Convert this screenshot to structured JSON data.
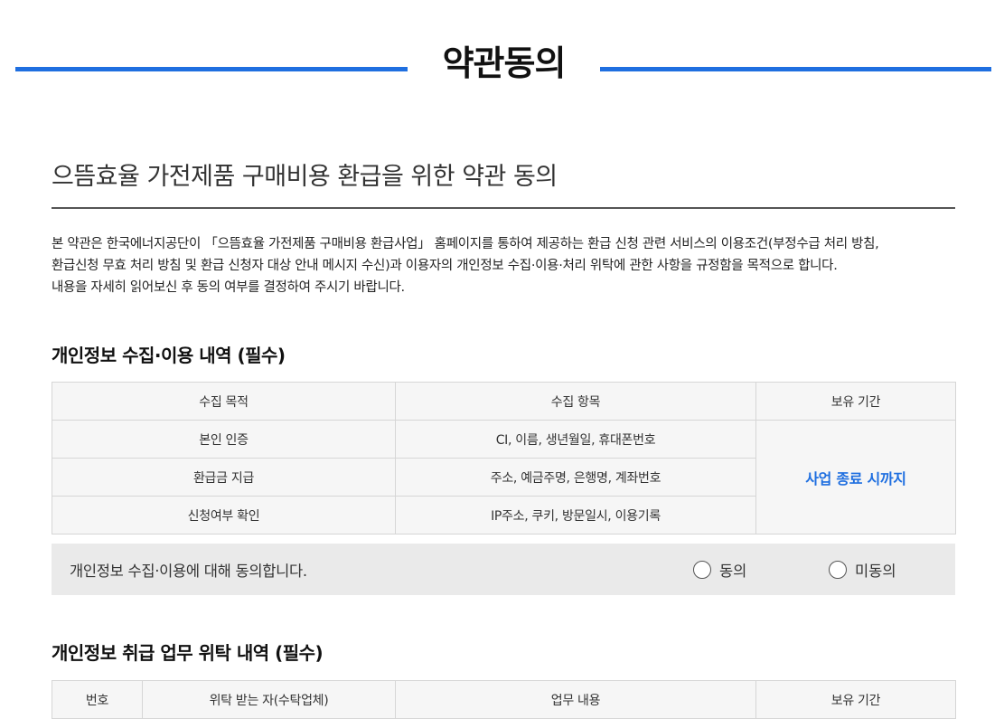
{
  "header": {
    "title": "약관동의"
  },
  "main": {
    "subtitle": "으뜸효율 가전제품 구매비용 환급을 위한 약관 동의",
    "intro": [
      "본 약관은 한국에너지공단이 「으뜸효율 가전제품 구매비용 환급사업」 홈페이지를 통하여 제공하는 환급 신청 관련 서비스의 이용조건(부정수급 처리 방침,",
      "환급신청 무효 처리 방침 및 환급 신청자 대상 안내 메시지 수신)과 이용자의 개인정보 수집·이용·처리 위탁에 관한 사항을 규정함을 목적으로 합니다.",
      "내용을 자세히 읽어보신 후 동의 여부를 결정하여 주시기 바랍니다."
    ]
  },
  "section1": {
    "title": "개인정보 수집·이용 내역 (필수)",
    "headers": [
      "수집 목적",
      "수집 항목",
      "보유 기간"
    ],
    "rows": [
      {
        "purpose": "본인 인증",
        "items": "CI, 이름, 생년월일, 휴대폰번호"
      },
      {
        "purpose": "환급금 지급",
        "items": "주소, 예금주명, 은행명, 계좌번호"
      },
      {
        "purpose": "신청여부 확인",
        "items": "IP주소, 쿠키, 방문일시, 이용기록"
      }
    ],
    "retention": "사업 종료 시까지",
    "consent": {
      "label": "개인정보 수집·이용에 대해 동의합니다.",
      "agree": "동의",
      "disagree": "미동의"
    }
  },
  "section2": {
    "title": "개인정보 취급 업무 위탁 내역 (필수)",
    "headers": [
      "번호",
      "위탁 받는 자(수탁업체)",
      "업무 내용",
      "보유 기간"
    ]
  },
  "colors": {
    "accent": "#1f6fe0",
    "table_bg": "#f6f6f6",
    "consent_bg": "#eaeaea"
  }
}
